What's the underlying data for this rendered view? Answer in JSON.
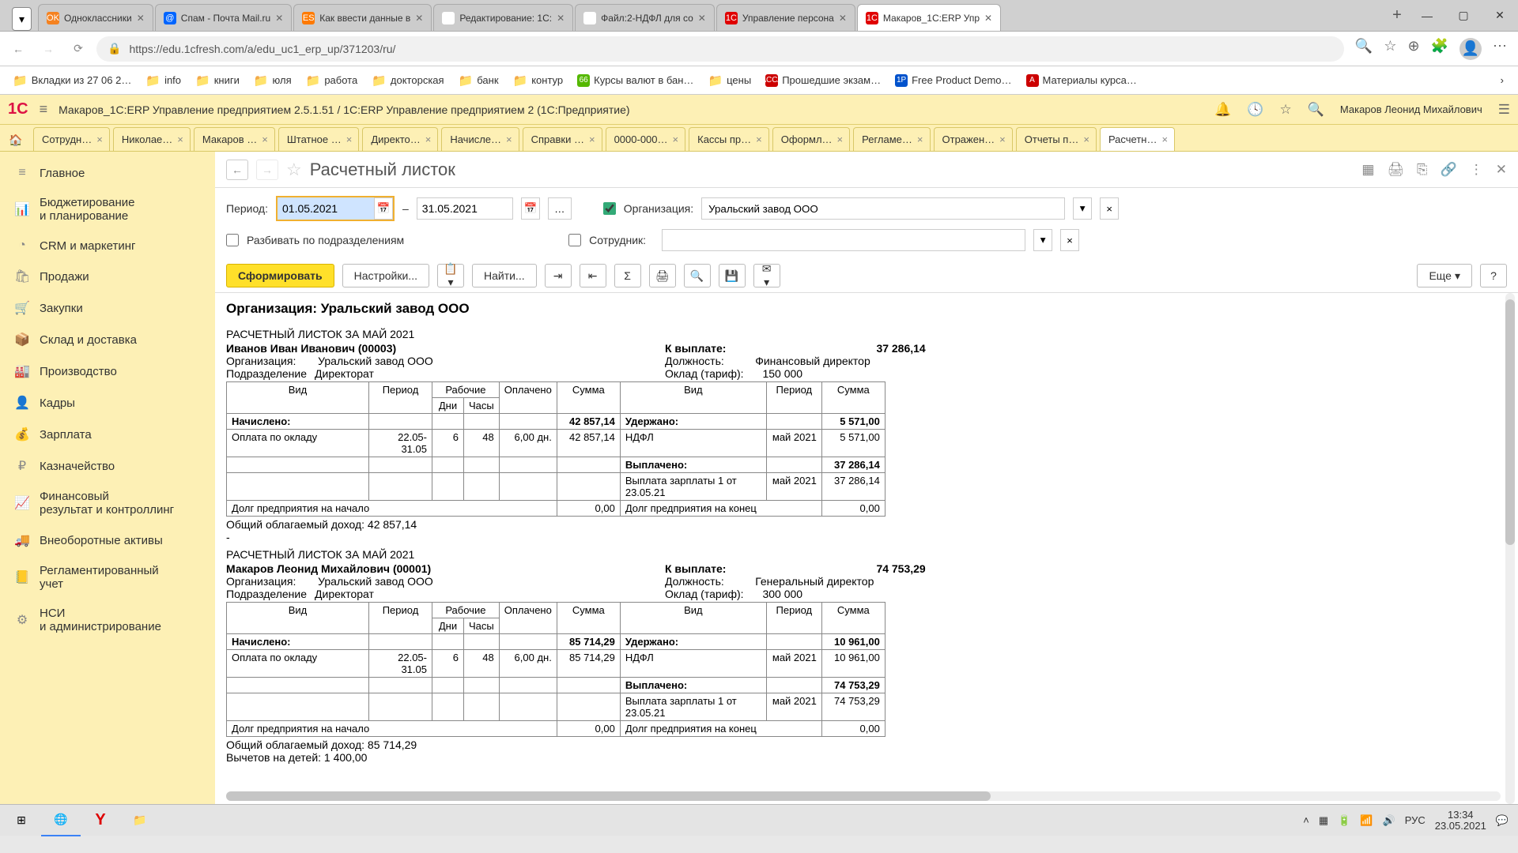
{
  "browser": {
    "tabs": [
      {
        "icon": "OK",
        "iconBg": "#f58220",
        "label": "Одноклассники"
      },
      {
        "icon": "@",
        "iconBg": "#0065ff",
        "label": "Спам - Почта Mail.ru"
      },
      {
        "icon": "ES",
        "iconBg": "#ff7a00",
        "label": "Как ввести данные в"
      },
      {
        "icon": "))",
        "iconBg": "#fff",
        "label": "Редактирование: 1С:"
      },
      {
        "icon": "))",
        "iconBg": "#fff",
        "label": "Файл:2-НДФЛ для со"
      },
      {
        "icon": "1C",
        "iconBg": "#e00000",
        "label": "Управление персона"
      },
      {
        "icon": "1C",
        "iconBg": "#e00000",
        "label": "Макаров_1C:ERP Упр",
        "active": true
      }
    ],
    "url": "https://edu.1cfresh.com/a/edu_uc1_erp_up/371203/ru/",
    "bookmarks": [
      {
        "t": "folder",
        "label": "Вкладки из 27 06 2…"
      },
      {
        "t": "folder",
        "label": "info"
      },
      {
        "t": "folder",
        "label": "книги"
      },
      {
        "t": "folder",
        "label": "юля"
      },
      {
        "t": "folder",
        "label": "работа"
      },
      {
        "t": "folder",
        "label": "докторская"
      },
      {
        "t": "folder",
        "label": "банк"
      },
      {
        "t": "folder",
        "label": "контур"
      },
      {
        "t": "icon",
        "icon": "66",
        "bg": "#55b800",
        "label": "Курсы валют в бан…"
      },
      {
        "t": "folder",
        "label": "цены"
      },
      {
        "t": "icon",
        "icon": "АССА",
        "bg": "#c00",
        "label": "Прошедшие экзам…"
      },
      {
        "t": "icon",
        "icon": "1P",
        "bg": "#0052cc",
        "label": "Free Product Demo…"
      },
      {
        "t": "icon",
        "icon": "A",
        "bg": "#c00",
        "label": "Материалы курса…"
      }
    ]
  },
  "app": {
    "title": "Макаров_1C:ERP Управление предприятием 2.5.1.51 / 1C:ERP Управление предприятием 2   (1С:Предприятие)",
    "user": "Макаров Леонид Михайлович",
    "tabs": [
      "Сотрудн…",
      "Николае…",
      "Макаров …",
      "Штатное …",
      "Директо…",
      "Начисле…",
      "Справки …",
      "0000-000…",
      "Кассы пр…",
      "Оформл…",
      "Регламе…",
      "Отражен…",
      "Отчеты п…",
      "Расчетн…"
    ],
    "activeTab": 13,
    "sidebar": [
      {
        "i": "≡",
        "l": "Главное"
      },
      {
        "i": "📊",
        "l": "Бюджетирование\nи планирование"
      },
      {
        "i": "◔",
        "l": "CRM и маркетинг"
      },
      {
        "i": "🛍",
        "l": "Продажи"
      },
      {
        "i": "🛒",
        "l": "Закупки"
      },
      {
        "i": "📦",
        "l": "Склад и доставка"
      },
      {
        "i": "🏭",
        "l": "Производство"
      },
      {
        "i": "👤",
        "l": "Кадры"
      },
      {
        "i": "💰",
        "l": "Зарплата"
      },
      {
        "i": "₽",
        "l": "Казначейство"
      },
      {
        "i": "📈",
        "l": "Финансовый\nрезультат и контроллинг"
      },
      {
        "i": "🚚",
        "l": "Внеоборотные активы"
      },
      {
        "i": "📒",
        "l": "Регламентированный\nучет"
      },
      {
        "i": "⚙",
        "l": "НСИ\nи администрирование"
      }
    ],
    "pageTitle": "Расчетный листок",
    "periodLabel": "Период:",
    "periodFrom": "01.05.2021",
    "periodTo": "31.05.2021",
    "splitLabel": "Разбивать по подразделениям",
    "orgLabel": "Организация:",
    "orgValue": "Уральский завод ООО",
    "empLabel": "Сотрудник:",
    "btnGenerate": "Сформировать",
    "btnSettings": "Настройки...",
    "btnFind": "Найти...",
    "btnMore": "Еще",
    "reportTitle": "Организация: Уральский завод ООО",
    "slip1": {
      "hdr": "РАСЧЕТНЫЙ ЛИСТОК ЗА МАЙ 2021",
      "emp": "Иванов Иван Иванович (00003)",
      "orgL": "Организация:",
      "org": "Уральский завод ООО",
      "depL": "Подразделение",
      "dep": "Директорат",
      "payL": "К выплате:",
      "pay": "37 286,14",
      "posL": "Должность:",
      "pos": "Финансовый директор",
      "salL": "Оклад (тариф):",
      "sal": "150 000",
      "h": [
        "Вид",
        "Период",
        "Рабочие",
        "Оплачено",
        "Сумма",
        "Вид",
        "Период",
        "Сумма"
      ],
      "h2": [
        "Дни",
        "Часы"
      ],
      "rows": [
        [
          "<b>Начислено:</b>",
          "",
          "",
          "",
          "",
          "<b>42 857,14</b>",
          "<b>Удержано:</b>",
          "",
          "<b>5 571,00</b>"
        ],
        [
          "Оплата по окладу",
          "22.05-31.05",
          "6",
          "48",
          "6,00 дн.",
          "42 857,14",
          "НДФЛ",
          "май 2021",
          "5 571,00"
        ],
        [
          "",
          "",
          "",
          "",
          "",
          "",
          "<b>Выплачено:</b>",
          "",
          "<b>37 286,14</b>"
        ],
        [
          "",
          "",
          "",
          "",
          "",
          "",
          "Выплата зарплаты 1 от 23.05.21",
          "май 2021",
          "37 286,14"
        ],
        [
          "Долг предприятия на начало",
          "",
          "",
          "",
          "",
          "0,00",
          "Долг предприятия на конец",
          "",
          "0,00"
        ]
      ],
      "total": "Общий облагаемый доход: 42 857,14"
    },
    "slip2": {
      "hdr": "РАСЧЕТНЫЙ ЛИСТОК ЗА МАЙ 2021",
      "emp": "Макаров Леонид Михайлович (00001)",
      "orgL": "Организация:",
      "org": "Уральский завод ООО",
      "depL": "Подразделение",
      "dep": "Директорат",
      "payL": "К выплате:",
      "pay": "74 753,29",
      "posL": "Должность:",
      "pos": "Генеральный директор",
      "salL": "Оклад (тариф):",
      "sal": "300 000",
      "rows": [
        [
          "<b>Начислено:</b>",
          "",
          "",
          "",
          "",
          "<b>85 714,29</b>",
          "<b>Удержано:</b>",
          "",
          "<b>10 961,00</b>"
        ],
        [
          "Оплата по окладу",
          "22.05-31.05",
          "6",
          "48",
          "6,00 дн.",
          "85 714,29",
          "НДФЛ",
          "май 2021",
          "10 961,00"
        ],
        [
          "",
          "",
          "",
          "",
          "",
          "",
          "<b>Выплачено:</b>",
          "",
          "<b>74 753,29</b>"
        ],
        [
          "",
          "",
          "",
          "",
          "",
          "",
          "Выплата зарплаты 1 от 23.05.21",
          "май 2021",
          "74 753,29"
        ],
        [
          "Долг предприятия на начало",
          "",
          "",
          "",
          "",
          "0,00",
          "Долг предприятия на конец",
          "",
          "0,00"
        ]
      ],
      "total": "Общий облагаемый доход: 85 714,29",
      "deduct": "Вычетов на детей: 1 400,00"
    }
  },
  "taskbar": {
    "lang": "РУС",
    "time": "13:34",
    "date": "23.05.2021"
  }
}
